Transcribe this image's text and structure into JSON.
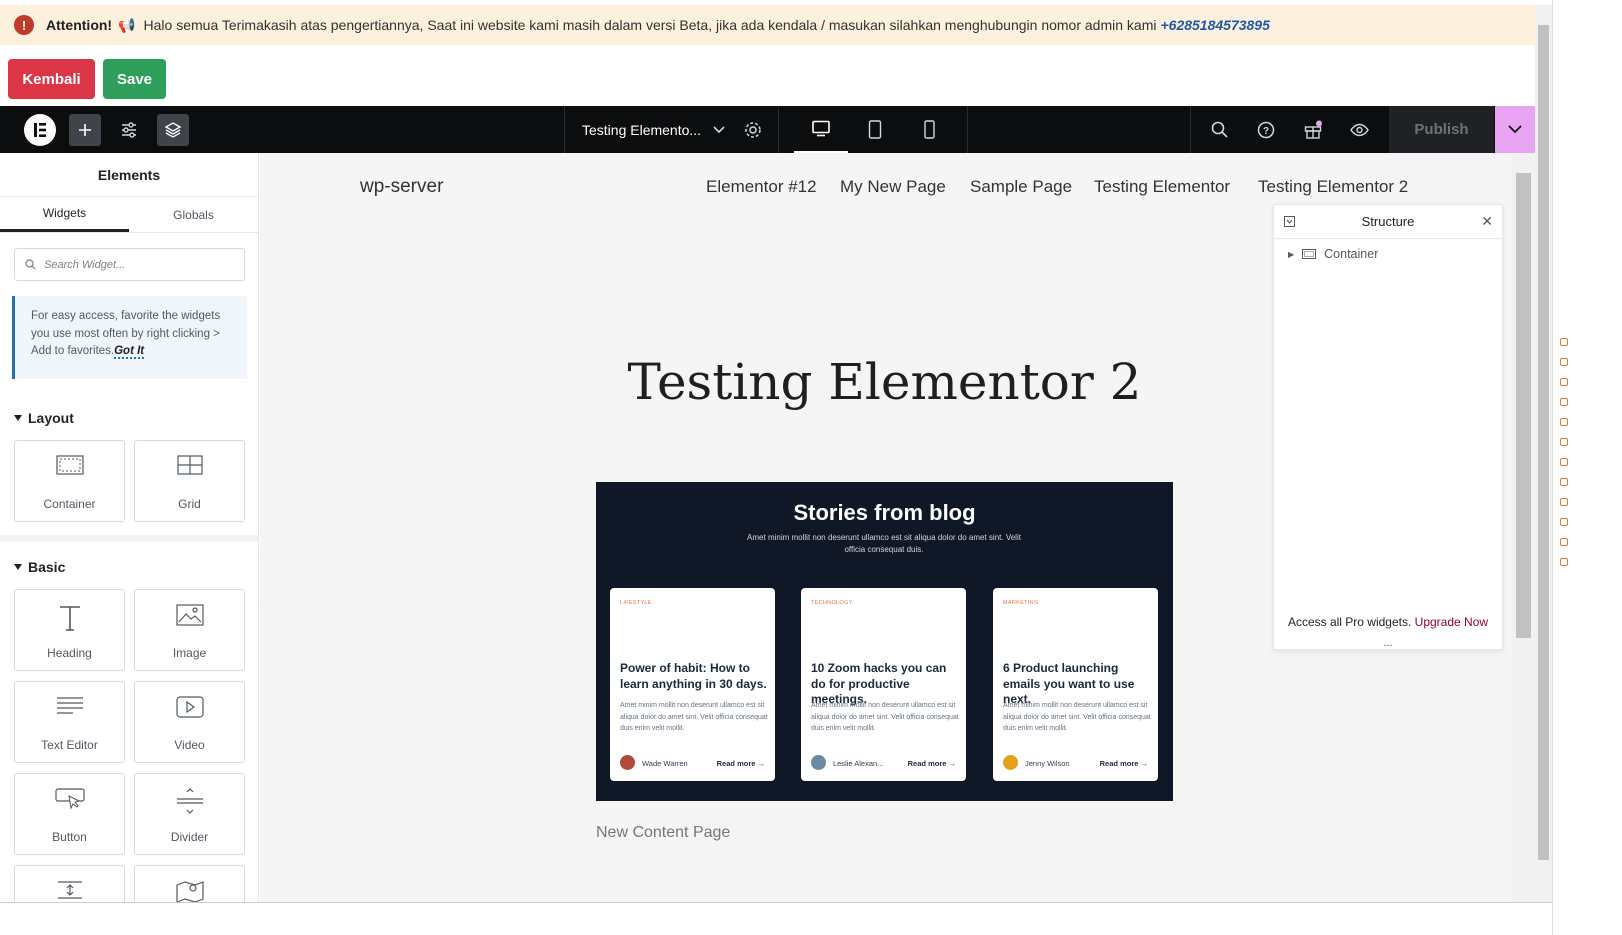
{
  "attention": {
    "label": "Attention!",
    "message": "Halo semua Terimakasih atas pengertiannya, Saat ini website kami masih dalam versi Beta, jika ada kendala / masukan silahkan menghubungin nomor admin kami",
    "phone": "+6285184573895",
    "icon": "exclamation-icon"
  },
  "actions": {
    "back_label": "Kembali",
    "save_label": "Save"
  },
  "topbar": {
    "document_title": "Testing Elemento...",
    "publish_label": "Publish",
    "accent": "#e9a4f3"
  },
  "panel": {
    "title": "Elements",
    "tabs": [
      "Widgets",
      "Globals"
    ],
    "search_placeholder": "Search Widget...",
    "tip_text": "For easy access, favorite the widgets you use most often by right clicking > Add to favorites.",
    "tip_link": "Got It",
    "layout": {
      "label": "Layout",
      "widgets": [
        "Container",
        "Grid"
      ]
    },
    "basic": {
      "label": "Basic",
      "widgets": [
        "Heading",
        "Image",
        "Text Editor",
        "Video",
        "Button",
        "Divider"
      ]
    }
  },
  "site": {
    "name": "wp-server",
    "nav": [
      "Elementor #12",
      "My New Page",
      "Sample Page",
      "Testing Elementor",
      "Testing Elementor 2"
    ],
    "page_title": "Testing Elementor 2",
    "footer_text": "New Content Page"
  },
  "blog": {
    "title": "Stories from blog",
    "subtitle": "Amet minim mollit non deserunt ullamco est sit aliqua dolor do amet sint. Velit officia consequat duis.",
    "cards": [
      {
        "tag": "LIFESTYLE",
        "title": "Power of habit: How to learn anything in 30 days.",
        "body": "Amet minim mollit non deserunt ullamco est sit aliqua dolor do amet sint. Velit officia consequat duis enim velit mollit.",
        "author": "Wade Warren",
        "more": "Read more"
      },
      {
        "tag": "TECHNOLOGY",
        "title": "10 Zoom hacks you can do for productive meetings.",
        "body": "Amet minim mollit non deserunt ullamco est sit aliqua dolor do amet sint. Velit officia consequat duis enim velit mollit.",
        "author": "Leslie Alexan...",
        "more": "Read more"
      },
      {
        "tag": "MARKETING",
        "title": "6 Product launching emails you want to use next.",
        "body": "Amet minim mollit non deserunt ullamco est sit aliqua dolor do amet sint. Velit officia consequat duis enim velit mollit.",
        "author": "Jenny Wilson",
        "more": "Read more"
      }
    ]
  },
  "structure": {
    "title": "Structure",
    "item": "Container",
    "footer_text": "Access all Pro widgets.",
    "footer_link": "Upgrade Now",
    "more": "..."
  }
}
